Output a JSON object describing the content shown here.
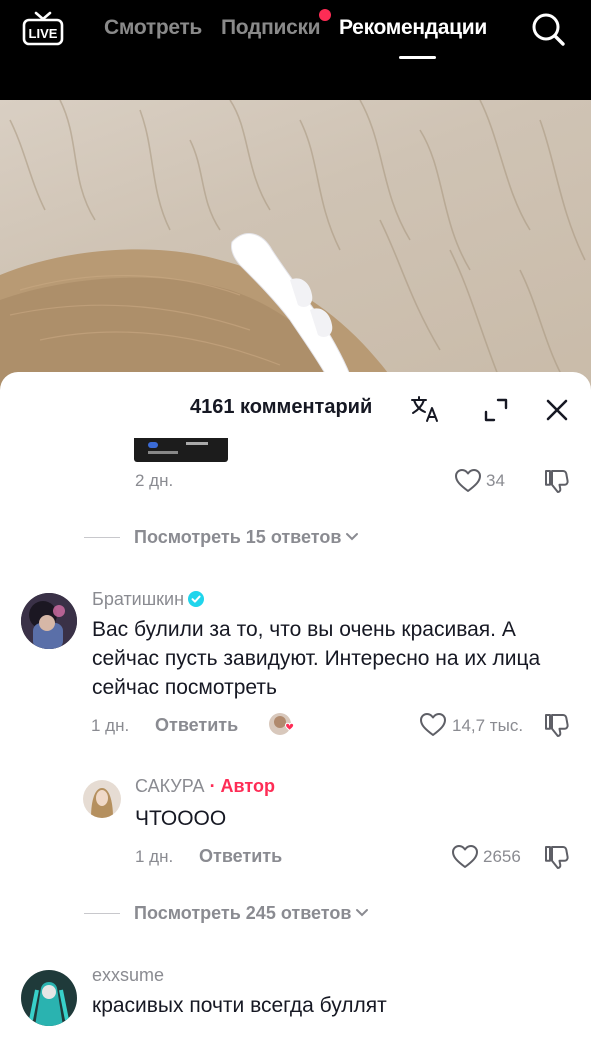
{
  "nav": {
    "live_label": "LIVE",
    "tabs": [
      {
        "label": "Смотреть"
      },
      {
        "label": "Подписки"
      },
      {
        "label": "Рекомендации"
      }
    ]
  },
  "sheet": {
    "title": "4161 комментарий"
  },
  "comments": [
    {
      "date": "2 дн.",
      "likes": "34"
    },
    {
      "username": "Братишкин",
      "text": "Вас булили за то, что вы очень красивая. А сейчас пусть завидуют. Интересно на их лица сейчас посмотреть",
      "date": "1 дн.",
      "reply_label": "Ответить",
      "likes": "14,7 тыс."
    },
    {
      "username": "САКУРА",
      "author_tag": "· Автор",
      "text": "ЧТОООО",
      "date": "1 дн.",
      "reply_label": "Ответить",
      "likes": "2656"
    },
    {
      "username": "exxsume",
      "text": "красивых почти всегда буллят"
    }
  ],
  "view_replies": [
    {
      "label": "Посмотреть 15 ответов"
    },
    {
      "label": "Посмотреть 245 ответов"
    }
  ],
  "colors": {
    "accent": "#fe2c55",
    "verified": "#20d5ec",
    "text": "#161823",
    "muted": "#8a8b91"
  }
}
